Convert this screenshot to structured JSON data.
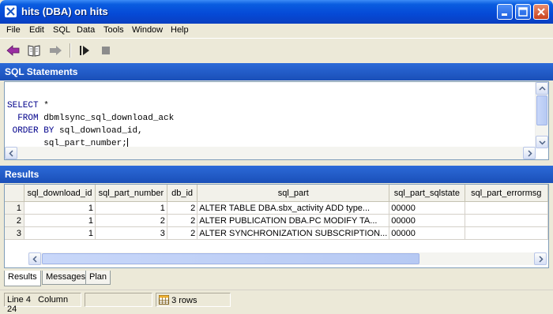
{
  "window": {
    "title": "hits (DBA) on hits"
  },
  "menu": {
    "items": [
      "File",
      "Edit",
      "SQL",
      "Data",
      "Tools",
      "Window",
      "Help"
    ]
  },
  "toolbar": {
    "icons": [
      "back-arrow-icon",
      "book-icon",
      "forward-arrow-icon",
      "execute-icon",
      "stop-icon"
    ]
  },
  "sql_panel": {
    "title": "SQL Statements",
    "lines": [
      {
        "kw": "SELECT",
        "rest": " *"
      },
      {
        "kw": "  FROM",
        "rest": " dbmlsync_sql_download_ack"
      },
      {
        "kw": " ORDER BY",
        "rest": " sql_download_id,"
      },
      {
        "kw": "",
        "rest": "       sql_part_number;"
      }
    ]
  },
  "results_panel": {
    "title": "Results",
    "columns": [
      "",
      "sql_download_id",
      "sql_part_number",
      "db_id",
      "sql_part",
      "sql_part_sqlstate",
      "sql_part_errormsg"
    ],
    "rows": [
      [
        "1",
        "1",
        "1",
        "2",
        "ALTER TABLE DBA.sbx_activity    ADD type...",
        "00000",
        ""
      ],
      [
        "2",
        "1",
        "2",
        "2",
        "ALTER PUBLICATION DBA.PC MODIFY    TA...",
        "00000",
        ""
      ],
      [
        "3",
        "1",
        "3",
        "2",
        "ALTER SYNCHRONIZATION SUBSCRIPTION...",
        "00000",
        ""
      ]
    ]
  },
  "tabs": [
    "Results",
    "Messages",
    "Plan"
  ],
  "status": {
    "line": "Line 4",
    "column": "Column 24",
    "rows": "3 rows"
  },
  "colors": {
    "title_blue": "#0a5de0",
    "panel_blue": "#1c58c4",
    "keyword": "#00008b"
  }
}
